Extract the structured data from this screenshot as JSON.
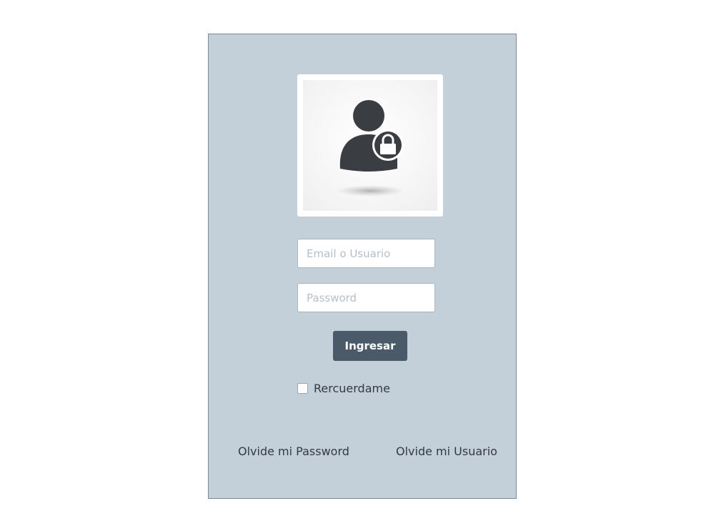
{
  "login": {
    "avatar": {
      "icon": "user-lock-icon"
    },
    "email_placeholder": "Email o Usuario",
    "email_value": "",
    "password_placeholder": "Password",
    "password_value": "",
    "submit_label": "Ingresar",
    "remember_label": "Rercuerdame",
    "remember_checked": false,
    "forgot_password_label": "Olvide mi Password",
    "forgot_user_label": "Olvide mi Usuario"
  },
  "colors": {
    "card_background": "#c3cfd9",
    "button_background": "#4a5a69",
    "icon_color": "#3a3d42"
  }
}
